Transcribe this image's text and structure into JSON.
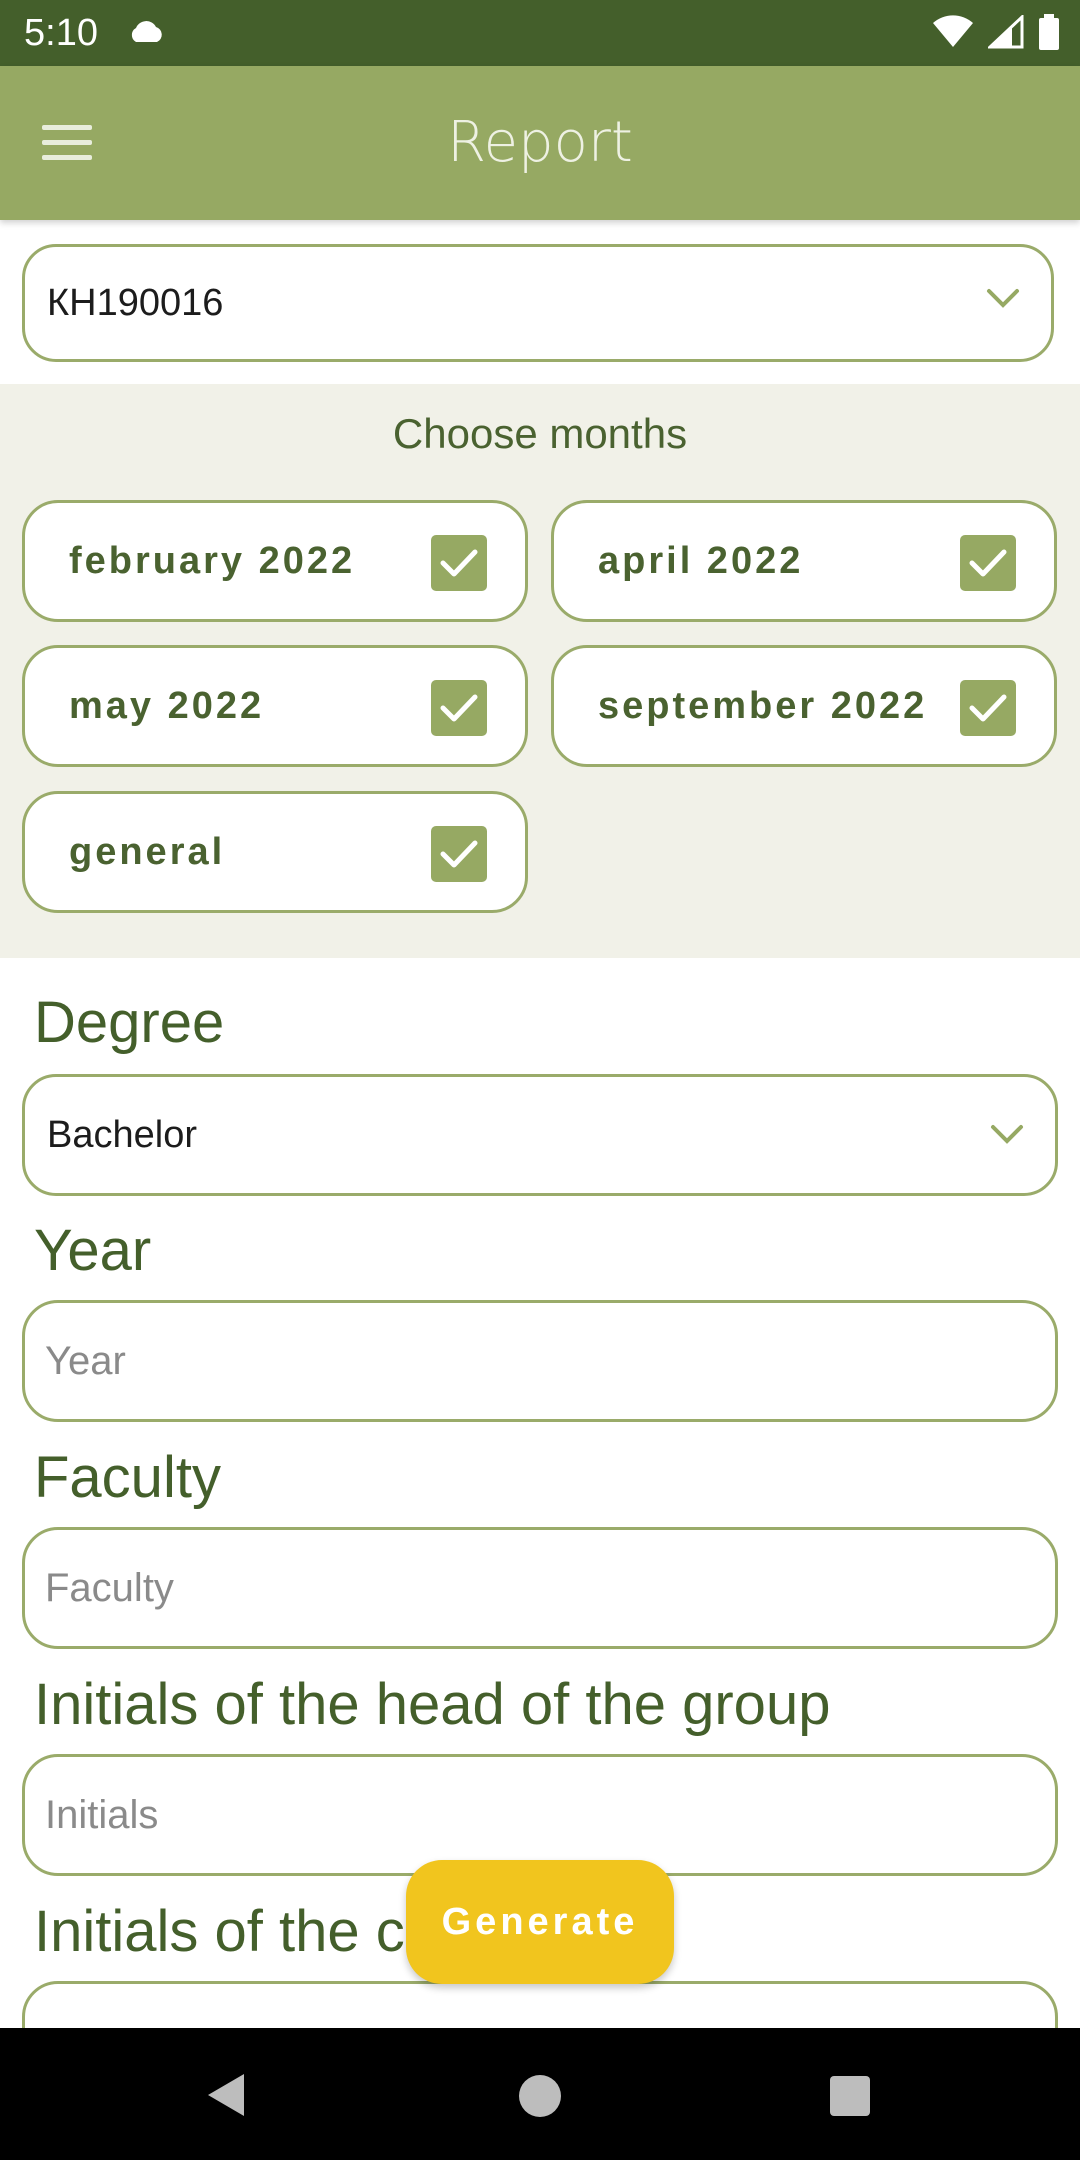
{
  "status_bar": {
    "time": "5:10",
    "icons": [
      "cloud-icon",
      "wifi-icon",
      "signal-icon",
      "battery-icon"
    ]
  },
  "app_bar": {
    "title": "Report",
    "menu_icon": "hamburger-menu-icon"
  },
  "group_select": {
    "value": "КН190016"
  },
  "months": {
    "title": "Choose months",
    "items": [
      {
        "label": "february 2022",
        "checked": true
      },
      {
        "label": "april 2022",
        "checked": true
      },
      {
        "label": "may 2022",
        "checked": true
      },
      {
        "label": "september 2022",
        "checked": true
      },
      {
        "label": "general",
        "checked": true
      }
    ]
  },
  "form": {
    "degree": {
      "label": "Degree",
      "value": "Bachelor"
    },
    "year": {
      "label": "Year",
      "placeholder": "Year",
      "value": ""
    },
    "faculty": {
      "label": "Faculty",
      "placeholder": "Faculty",
      "value": ""
    },
    "head_initials": {
      "label": "Initials of the head of the group",
      "placeholder": "Initials",
      "value": ""
    },
    "next_label_visible": "Initials of the c"
  },
  "generate_button": {
    "label": "Generate"
  },
  "colors": {
    "status_bar": "#445f2b",
    "app_bar": "#96a963",
    "accent_text": "#445f2b",
    "border": "#9aab6a",
    "months_bg": "#f1f1e8",
    "button": "#f1c51e"
  },
  "nav_bar": {
    "icons": [
      "back-icon",
      "home-icon",
      "recents-icon"
    ]
  }
}
